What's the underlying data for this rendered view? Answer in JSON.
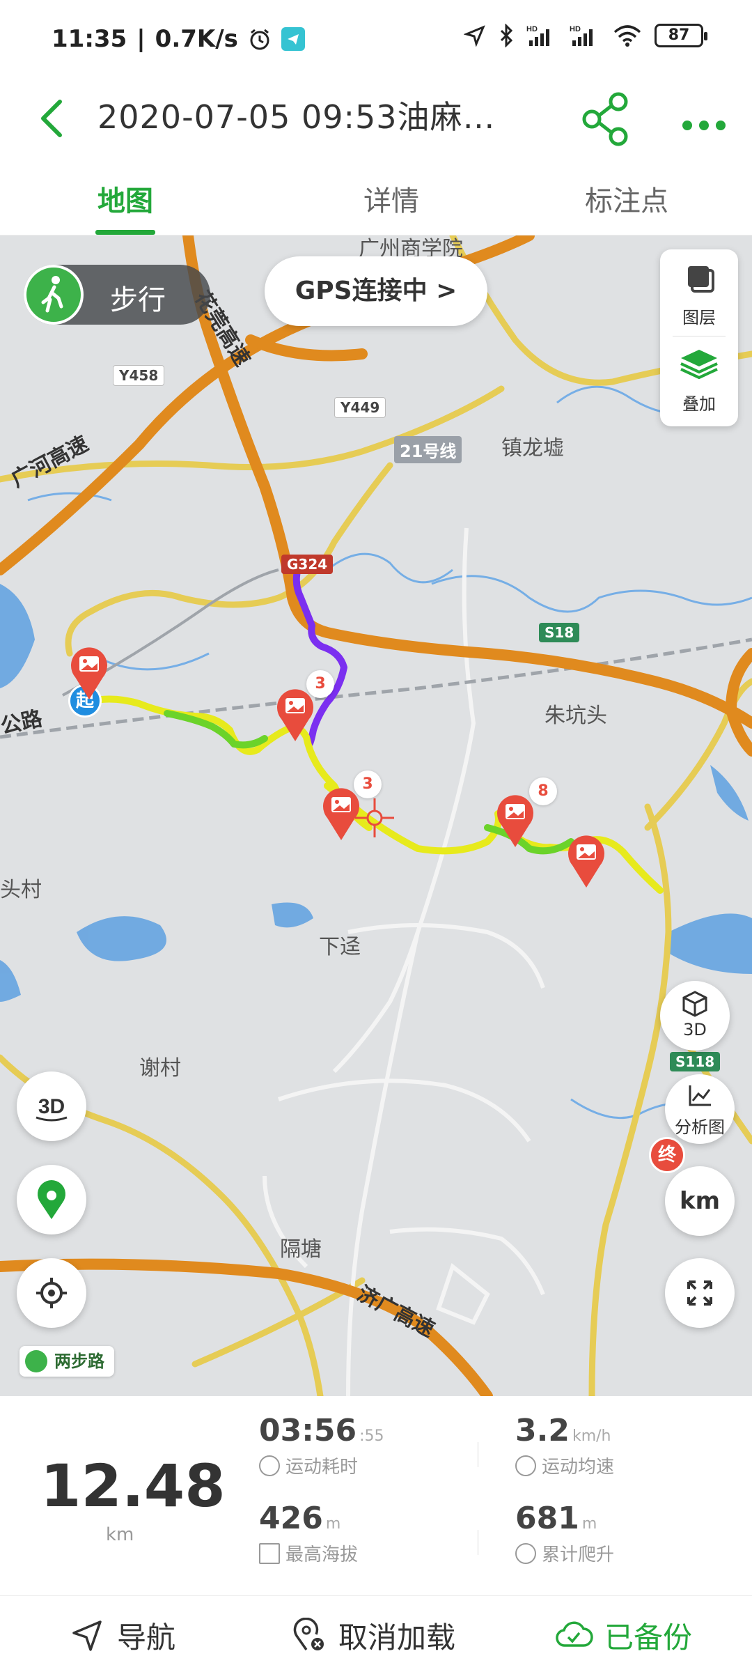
{
  "status_bar": {
    "time": "11:35",
    "net_speed": "0.7K/s",
    "battery": "87"
  },
  "header": {
    "title": "2020-07-05 09:53油麻…"
  },
  "tabs": [
    {
      "label": "地图",
      "active": true
    },
    {
      "label": "详情",
      "active": false
    },
    {
      "label": "标注点",
      "active": false
    }
  ],
  "map": {
    "mode_label": "步行",
    "gps_status": "GPS连接中 >",
    "layers_label": "图层",
    "overlay_label": "叠加",
    "btn_3d_label": "3D",
    "btn_analysis_label": "分析图",
    "btn_km_label": "km",
    "start_label": "起",
    "end_label": "终",
    "brand_label": "两步路",
    "pin_counts": [
      "3",
      "3",
      "8"
    ],
    "places": {
      "p1": "广州商学院",
      "p2": "镇龙墟",
      "p3": "朱坑头",
      "p4": "下迳",
      "p5": "谢村",
      "p6": "隔塘",
      "p7": "头村"
    },
    "roads": {
      "r1": "花莞高速",
      "r2": "广河高速",
      "r3": "济广高速",
      "r4": "Y458",
      "r5": "Y449",
      "r6": "21号线",
      "r7": "G324",
      "r8": "S18",
      "r9": "S118",
      "r10": "公路"
    },
    "colors": {
      "highway": "#e08a1e",
      "secondary": "#e6cc55",
      "water": "#5ea0e0",
      "route_purple": "#7b2ff0",
      "route_yellow": "#e7ea1c",
      "route_green": "#6bd32a",
      "accent": "#23a83a"
    }
  },
  "stats": {
    "distance": {
      "value": "12.48",
      "unit": "km"
    },
    "duration": {
      "value": "03:56",
      "seconds": ":55",
      "caption": "运动耗时"
    },
    "avg_speed": {
      "value": "3.2",
      "unit": "km/h",
      "caption": "运动均速"
    },
    "max_alt": {
      "value": "426",
      "unit": "m",
      "caption": "最高海拔"
    },
    "total_climb": {
      "value": "681",
      "unit": "m",
      "caption": "累计爬升"
    }
  },
  "bottom_bar": {
    "navigate": "导航",
    "unload": "取消加载",
    "backed_up": "已备份"
  }
}
